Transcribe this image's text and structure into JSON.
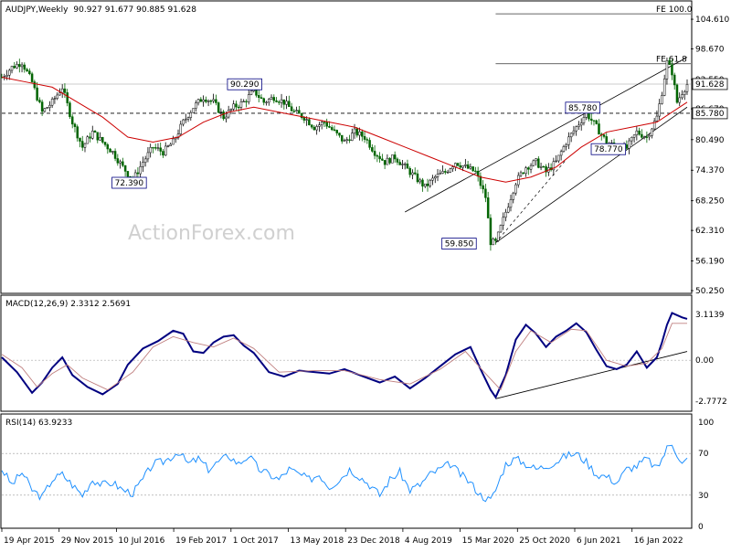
{
  "chart_data": [
    {
      "type": "candlestick",
      "title": "AUDJPY,Weekly",
      "ohlc_text": "90.927 91.677 90.885 91.628",
      "ylim": [
        50.25,
        107.0
      ],
      "y_ticks": [
        "104.610",
        "98.670",
        "92.550",
        "86.670",
        "80.490",
        "74.370",
        "68.250",
        "62.310",
        "56.190",
        "50.250"
      ],
      "last_price": "91.628",
      "price_marker": "85.780",
      "levels": [
        {
          "label": "FE 100.0",
          "value": 105.7
        },
        {
          "label": "FE 61.8",
          "value": 95.7
        }
      ],
      "annotations": [
        "72.390",
        "90.290",
        "59.850",
        "85.780",
        "78.770"
      ],
      "watermark": "ActionForex.com",
      "price_path": [
        [
          0,
          93
        ],
        [
          4,
          95
        ],
        [
          8,
          96
        ],
        [
          12,
          92
        ],
        [
          16,
          86
        ],
        [
          20,
          88
        ],
        [
          24,
          91
        ],
        [
          28,
          84
        ],
        [
          32,
          79
        ],
        [
          36,
          82
        ],
        [
          40,
          80
        ],
        [
          44,
          78
        ],
        [
          48,
          75
        ],
        [
          52,
          72.4
        ],
        [
          56,
          76
        ],
        [
          60,
          79
        ],
        [
          64,
          78
        ],
        [
          68,
          80
        ],
        [
          72,
          84
        ],
        [
          76,
          87
        ],
        [
          80,
          89
        ],
        [
          84,
          88
        ],
        [
          88,
          85
        ],
        [
          92,
          87
        ],
        [
          96,
          88
        ],
        [
          100,
          90.3
        ],
        [
          104,
          88
        ],
        [
          108,
          89
        ],
        [
          112,
          88
        ],
        [
          116,
          86
        ],
        [
          120,
          85
        ],
        [
          124,
          83
        ],
        [
          128,
          84
        ],
        [
          132,
          82
        ],
        [
          136,
          80
        ],
        [
          140,
          82
        ],
        [
          144,
          81
        ],
        [
          148,
          78
        ],
        [
          152,
          76
        ],
        [
          156,
          77
        ],
        [
          160,
          75
        ],
        [
          164,
          73
        ],
        [
          168,
          71
        ],
        [
          172,
          73
        ],
        [
          176,
          74
        ],
        [
          180,
          76
        ],
        [
          184,
          75
        ],
        [
          188,
          74
        ],
        [
          192,
          69
        ],
        [
          194,
          60
        ],
        [
          196,
          59.85
        ],
        [
          200,
          66
        ],
        [
          204,
          72
        ],
        [
          208,
          75
        ],
        [
          212,
          76
        ],
        [
          216,
          74
        ],
        [
          220,
          76
        ],
        [
          224,
          80
        ],
        [
          228,
          83
        ],
        [
          232,
          85.8
        ],
        [
          236,
          83
        ],
        [
          240,
          80
        ],
        [
          244,
          79
        ],
        [
          248,
          78.77
        ],
        [
          252,
          82
        ],
        [
          256,
          81
        ],
        [
          260,
          85
        ],
        [
          262,
          90
        ],
        [
          264,
          96
        ],
        [
          266,
          94
        ],
        [
          268,
          88
        ],
        [
          270,
          90
        ],
        [
          272,
          91.6
        ]
      ],
      "ma_path": [
        [
          0,
          93
        ],
        [
          10,
          92
        ],
        [
          20,
          91
        ],
        [
          30,
          88
        ],
        [
          40,
          85
        ],
        [
          50,
          81
        ],
        [
          60,
          80
        ],
        [
          70,
          81
        ],
        [
          80,
          84
        ],
        [
          90,
          86
        ],
        [
          100,
          87
        ],
        [
          110,
          86
        ],
        [
          120,
          85
        ],
        [
          130,
          84
        ],
        [
          140,
          83
        ],
        [
          150,
          81
        ],
        [
          160,
          79
        ],
        [
          170,
          77
        ],
        [
          180,
          75
        ],
        [
          190,
          73
        ],
        [
          200,
          72
        ],
        [
          210,
          73
        ],
        [
          220,
          75
        ],
        [
          230,
          79
        ],
        [
          240,
          82
        ],
        [
          250,
          83
        ],
        [
          260,
          84
        ],
        [
          272,
          88
        ]
      ],
      "channel_lines": [
        {
          "from": [
            160,
            66
          ],
          "to": [
            272,
            97
          ]
        },
        {
          "from": [
            196,
            59.85
          ],
          "to": [
            272,
            87
          ]
        }
      ],
      "x_labels": [
        "19 Apr 2015",
        "29 Nov 2015",
        "10 Jul 2016",
        "19 Feb 2017",
        "1 Oct 2017",
        "13 May 2018",
        "23 Dec 2018",
        "4 Aug 2019",
        "15 Mar 2020",
        "25 Oct 2020",
        "6 Jun 2021",
        "16 Jan 2022"
      ]
    },
    {
      "type": "line",
      "title": "MACD(12,26,9) 2.3312 2.5691",
      "ylim": [
        -3.2,
        3.6
      ],
      "y_ticks": [
        "3.1139",
        "0.00",
        "-2.7772"
      ],
      "series": [
        {
          "name": "MACD",
          "color": "#000080",
          "values": [
            [
              0,
              0.2
            ],
            [
              6,
              -0.8
            ],
            [
              12,
              -2.2
            ],
            [
              16,
              -1.5
            ],
            [
              20,
              -0.5
            ],
            [
              24,
              0.2
            ],
            [
              28,
              -1.0
            ],
            [
              34,
              -1.8
            ],
            [
              40,
              -2.3
            ],
            [
              46,
              -1.6
            ],
            [
              50,
              -0.3
            ],
            [
              56,
              0.8
            ],
            [
              62,
              1.3
            ],
            [
              68,
              2.0
            ],
            [
              72,
              1.8
            ],
            [
              76,
              0.6
            ],
            [
              80,
              0.5
            ],
            [
              84,
              1.2
            ],
            [
              88,
              1.6
            ],
            [
              92,
              1.7
            ],
            [
              96,
              1.0
            ],
            [
              100,
              0.5
            ],
            [
              106,
              -0.8
            ],
            [
              112,
              -1.1
            ],
            [
              118,
              -0.7
            ],
            [
              124,
              -0.8
            ],
            [
              130,
              -0.9
            ],
            [
              136,
              -0.6
            ],
            [
              142,
              -1.0
            ],
            [
              150,
              -1.5
            ],
            [
              156,
              -1.1
            ],
            [
              162,
              -1.9
            ],
            [
              168,
              -1.2
            ],
            [
              174,
              -0.4
            ],
            [
              180,
              0.4
            ],
            [
              186,
              0.9
            ],
            [
              190,
              -0.6
            ],
            [
              194,
              -2.0
            ],
            [
              196,
              -2.5
            ],
            [
              200,
              -1.0
            ],
            [
              204,
              1.4
            ],
            [
              208,
              2.4
            ],
            [
              212,
              1.8
            ],
            [
              216,
              0.9
            ],
            [
              220,
              1.6
            ],
            [
              224,
              2.0
            ],
            [
              228,
              2.5
            ],
            [
              232,
              1.9
            ],
            [
              236,
              0.7
            ],
            [
              240,
              -0.4
            ],
            [
              244,
              -0.6
            ],
            [
              248,
              -0.3
            ],
            [
              252,
              0.6
            ],
            [
              256,
              -0.5
            ],
            [
              260,
              0.2
            ],
            [
              262,
              1.2
            ],
            [
              264,
              2.4
            ],
            [
              266,
              3.2
            ],
            [
              270,
              2.9
            ],
            [
              272,
              2.8
            ]
          ]
        },
        {
          "name": "Signal",
          "color": "#c08080",
          "values": [
            [
              0,
              0.4
            ],
            [
              8,
              -0.5
            ],
            [
              14,
              -1.8
            ],
            [
              20,
              -0.9
            ],
            [
              26,
              -0.3
            ],
            [
              32,
              -1.2
            ],
            [
              42,
              -2.0
            ],
            [
              52,
              -0.8
            ],
            [
              60,
              0.9
            ],
            [
              68,
              1.6
            ],
            [
              76,
              1.2
            ],
            [
              84,
              0.9
            ],
            [
              92,
              1.5
            ],
            [
              100,
              0.8
            ],
            [
              110,
              -0.8
            ],
            [
              124,
              -0.7
            ],
            [
              136,
              -0.7
            ],
            [
              150,
              -1.3
            ],
            [
              162,
              -1.6
            ],
            [
              174,
              -0.6
            ],
            [
              184,
              0.6
            ],
            [
              192,
              -0.9
            ],
            [
              198,
              -2.0
            ],
            [
              204,
              0.6
            ],
            [
              210,
              2.0
            ],
            [
              218,
              1.2
            ],
            [
              226,
              2.1
            ],
            [
              232,
              2.0
            ],
            [
              240,
              0.0
            ],
            [
              248,
              -0.4
            ],
            [
              256,
              -0.2
            ],
            [
              262,
              0.8
            ],
            [
              266,
              2.5
            ],
            [
              272,
              2.5
            ]
          ]
        }
      ],
      "trendline": {
        "from": [
          196,
          -2.6
        ],
        "to": [
          272,
          0.6
        ]
      }
    },
    {
      "type": "line",
      "title": "RSI(14) 63.9233",
      "ylim": [
        0,
        100
      ],
      "y_ticks": [
        "100",
        "70",
        "30",
        "0"
      ],
      "reference_levels": [
        30,
        70
      ],
      "series": [
        {
          "name": "RSI",
          "color": "#1e90ff",
          "values": [
            [
              0,
              55
            ],
            [
              4,
              40
            ],
            [
              8,
              52
            ],
            [
              12,
              35
            ],
            [
              16,
              28
            ],
            [
              20,
              45
            ],
            [
              24,
              50
            ],
            [
              28,
              40
            ],
            [
              32,
              30
            ],
            [
              36,
              45
            ],
            [
              40,
              40
            ],
            [
              44,
              42
            ],
            [
              48,
              35
            ],
            [
              52,
              32
            ],
            [
              56,
              45
            ],
            [
              60,
              60
            ],
            [
              64,
              62
            ],
            [
              68,
              68
            ],
            [
              70,
              72
            ],
            [
              74,
              60
            ],
            [
              78,
              65
            ],
            [
              82,
              55
            ],
            [
              86,
              62
            ],
            [
              90,
              68
            ],
            [
              94,
              60
            ],
            [
              98,
              68
            ],
            [
              102,
              55
            ],
            [
              106,
              50
            ],
            [
              110,
              45
            ],
            [
              114,
              55
            ],
            [
              118,
              50
            ],
            [
              122,
              45
            ],
            [
              126,
              50
            ],
            [
              130,
              38
            ],
            [
              134,
              45
            ],
            [
              138,
              55
            ],
            [
              142,
              48
            ],
            [
              146,
              40
            ],
            [
              150,
              30
            ],
            [
              154,
              45
            ],
            [
              158,
              52
            ],
            [
              162,
              35
            ],
            [
              166,
              40
            ],
            [
              170,
              50
            ],
            [
              174,
              55
            ],
            [
              178,
              60
            ],
            [
              182,
              50
            ],
            [
              186,
              42
            ],
            [
              190,
              30
            ],
            [
              194,
              25
            ],
            [
              196,
              35
            ],
            [
              200,
              60
            ],
            [
              204,
              65
            ],
            [
              208,
              60
            ],
            [
              212,
              55
            ],
            [
              216,
              58
            ],
            [
              220,
              62
            ],
            [
              224,
              68
            ],
            [
              228,
              70
            ],
            [
              232,
              62
            ],
            [
              236,
              50
            ],
            [
              240,
              48
            ],
            [
              244,
              42
            ],
            [
              248,
              55
            ],
            [
              252,
              58
            ],
            [
              256,
              65
            ],
            [
              260,
              55
            ],
            [
              262,
              65
            ],
            [
              264,
              75
            ],
            [
              266,
              80
            ],
            [
              268,
              70
            ],
            [
              270,
              60
            ],
            [
              272,
              64
            ]
          ]
        }
      ]
    }
  ]
}
